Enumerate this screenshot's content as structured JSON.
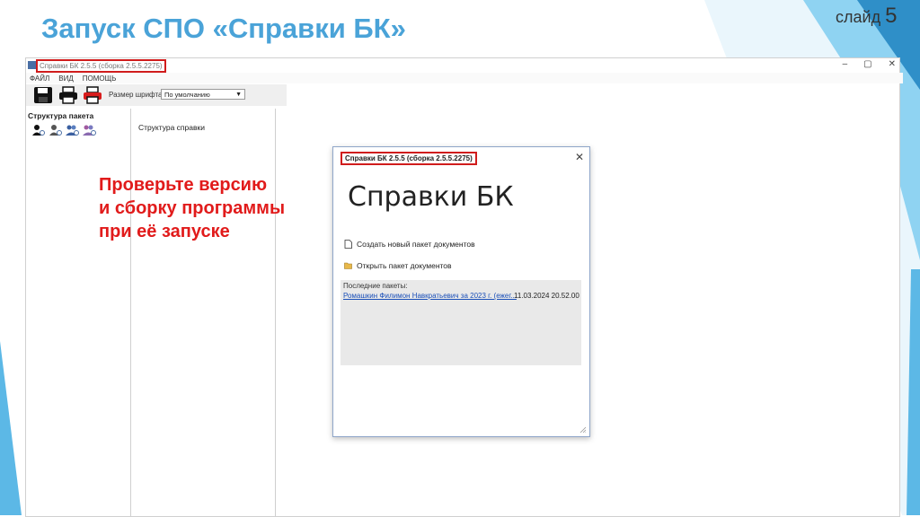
{
  "slide": {
    "title": "Запуск СПО «Справки БК»",
    "number_label": "слайд",
    "number": "5"
  },
  "colors": {
    "accent": "#4aa3d8",
    "annotation": "#e11b1b",
    "highlight_border": "#d01c1c",
    "link": "#1a4fb8"
  },
  "app": {
    "window_title": "Справки БК 2.5.5 (сборка 2.5.5.2275)",
    "window_buttons": [
      "–",
      "▢",
      "✕"
    ],
    "menu": [
      "ФАЙЛ",
      "ВИД",
      "ПОМОЩЬ"
    ],
    "toolbar": {
      "icons": [
        "save-icon",
        "print-icon",
        "print-red-icon"
      ],
      "font_size_label": "Размер шрифта:",
      "font_size_value": "По умолчанию"
    },
    "left_panel": {
      "title": "Структура пакета",
      "icons": [
        "user-add-icon",
        "user-add-icon",
        "users-add-icon",
        "users-add-icon"
      ]
    },
    "middle_panel": {
      "label": "Структура справки"
    }
  },
  "annotation": {
    "lines": [
      "Проверьте версию",
      "и сборку программы",
      "при её запуске"
    ]
  },
  "dialog": {
    "title": "Справки БК 2.5.5 (сборка 2.5.5.2275)",
    "close": "✕",
    "heading": "Справки БК",
    "action_new": "Создать новый пакет документов",
    "action_open": "Открыть пакет документов",
    "recent_label": "Последние пакеты:",
    "recent_items": [
      {
        "name": "Ромашкин Филимон Навкратьевич за 2023 г. (ежег...",
        "date": "11.03.2024 20.52.00"
      }
    ]
  }
}
